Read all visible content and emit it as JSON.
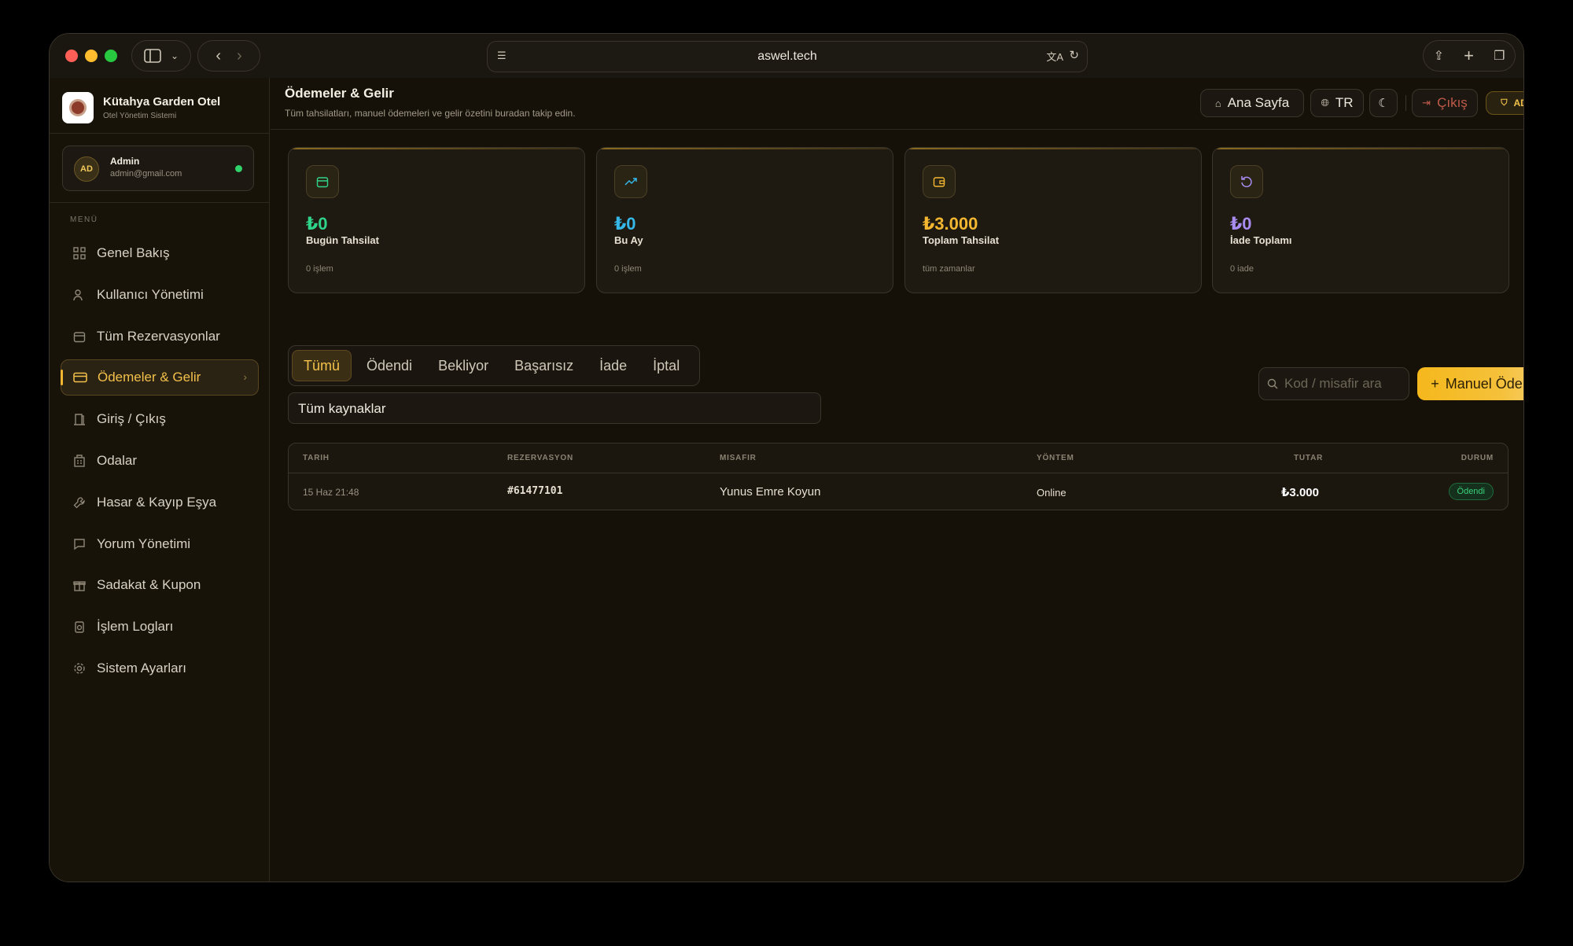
{
  "browser": {
    "url": "aswel.tech",
    "colors": {
      "red": "#ff5f57",
      "yellow": "#febc2e",
      "green": "#28c840"
    }
  },
  "sidebar": {
    "brand": {
      "title": "Kütahya Garden Otel",
      "subtitle": "Otel Yönetim Sistemi"
    },
    "user": {
      "initials": "AD",
      "name": "Admin",
      "email": "admin@gmail.com",
      "status_color": "#2fd26b"
    },
    "menu_title": "MENÜ",
    "items": [
      {
        "label": "Genel Bakış",
        "icon": "grid-icon"
      },
      {
        "label": "Kullanıcı Yönetimi",
        "icon": "users-icon"
      },
      {
        "label": "Tüm Rezervasyonlar",
        "icon": "calendar-icon"
      },
      {
        "label": "Ödemeler & Gelir",
        "icon": "credit-card-icon",
        "active": true
      },
      {
        "label": "Giriş / Çıkış",
        "icon": "door-icon"
      },
      {
        "label": "Odalar",
        "icon": "building-icon"
      },
      {
        "label": "Hasar & Kayıp Eşya",
        "icon": "wrench-icon"
      },
      {
        "label": "Yorum Yönetimi",
        "icon": "message-icon"
      },
      {
        "label": "Sadakat & Kupon",
        "icon": "gift-icon"
      },
      {
        "label": "İşlem Logları",
        "icon": "log-icon"
      },
      {
        "label": "Sistem Ayarları",
        "icon": "gear-icon"
      }
    ]
  },
  "header": {
    "title": "Ödemeler & Gelir",
    "subtitle": "Tüm tahsilatları, manuel ödemeleri ve gelir özetini buradan takip edin.",
    "home_label": "Ana Sayfa",
    "lang_label": "TR",
    "logout_label": "Çıkış",
    "role_label": "ADMIN"
  },
  "stats": [
    {
      "value": "₺0",
      "label": "Bugün Tahsilat",
      "note": "0 işlem",
      "color": "#2fd38a",
      "icon": "calendar-icon"
    },
    {
      "value": "₺0",
      "label": "Bu Ay",
      "note": "0 işlem",
      "color": "#35b7e8",
      "icon": "trend-up-icon"
    },
    {
      "value": "₺3.000",
      "label": "Toplam Tahsilat",
      "note": "tüm zamanlar",
      "color": "#f3b630",
      "icon": "wallet-icon"
    },
    {
      "value": "₺0",
      "label": "İade Toplamı",
      "note": "0 iade",
      "color": "#a98cf0",
      "icon": "refresh-icon"
    }
  ],
  "tabs": [
    "Tümü",
    "Ödendi",
    "Bekliyor",
    "Başarısız",
    "İade",
    "İptal"
  ],
  "active_tab": 0,
  "source_filter": "Tüm kaynaklar",
  "search": {
    "placeholder": "Kod / misafir ara"
  },
  "manual_button": "Manuel Ödeme",
  "table": {
    "columns": [
      "TARIH",
      "REZERVASYON",
      "MISAFIR",
      "YÖNTEM",
      "TUTAR",
      "DURUM"
    ],
    "rows": [
      {
        "date": "15 Haz 21:48",
        "reservation": "#61477101",
        "guest": "Yunus Emre Koyun",
        "method": "Online",
        "amount": "₺3.000",
        "status": "Ödendi"
      }
    ]
  }
}
